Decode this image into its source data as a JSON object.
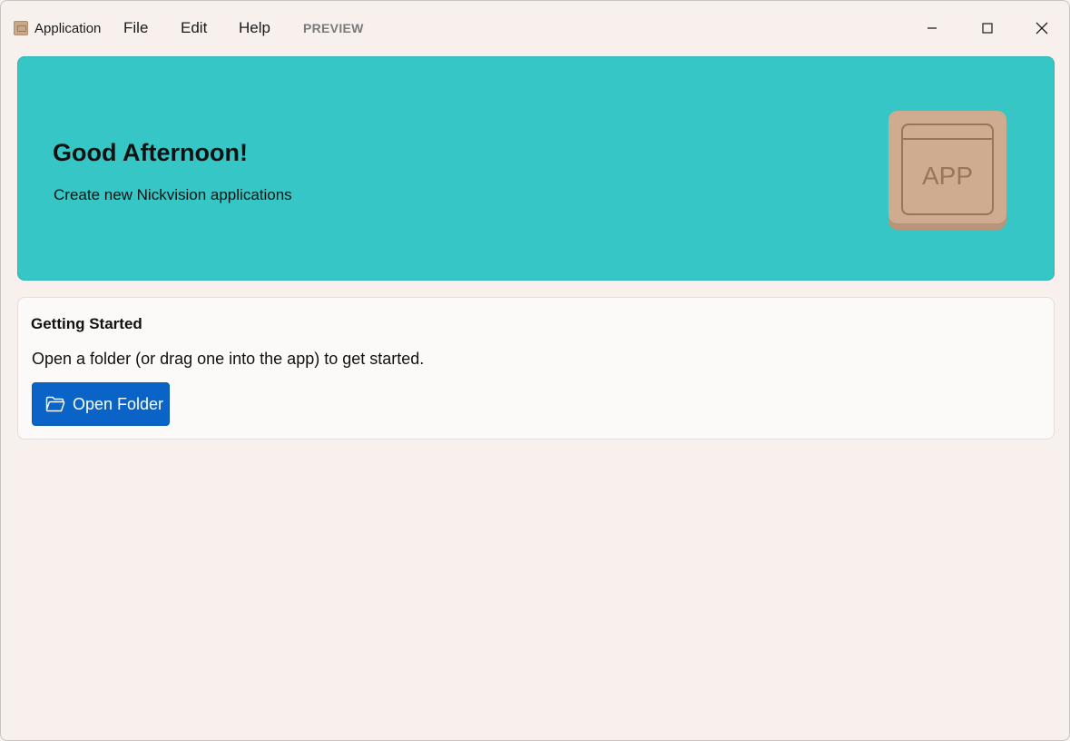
{
  "titlebar": {
    "app_title": "Application",
    "menus": [
      {
        "label": "File"
      },
      {
        "label": "Edit"
      },
      {
        "label": "Help"
      }
    ],
    "preview_label": "PREVIEW"
  },
  "hero": {
    "greeting": "Good Afternoon!",
    "subtitle": "Create new Nickvision applications",
    "icon_label": "APP",
    "background_color": "#35c6c5"
  },
  "getting_started": {
    "title": "Getting Started",
    "description": "Open a folder (or drag one into the app) to get started.",
    "button_label": "Open Folder",
    "button_color": "#0a63c6"
  },
  "icons": {
    "window_controls": [
      "minimize-icon",
      "maximize-icon",
      "close-icon"
    ],
    "button_icon": "folder-icon"
  }
}
